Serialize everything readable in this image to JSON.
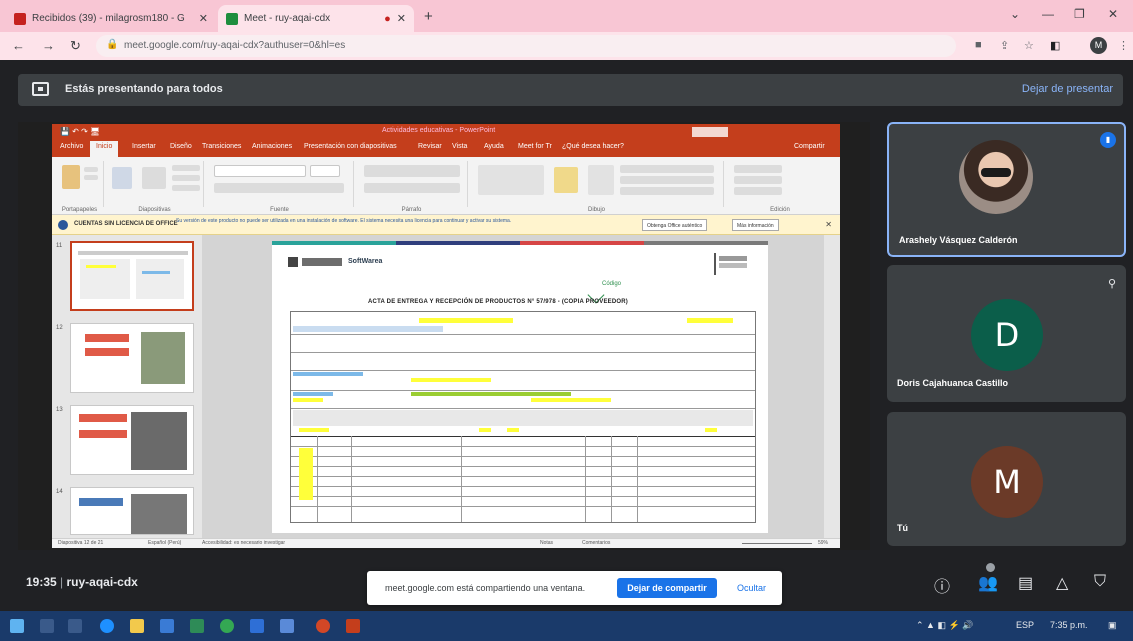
{
  "browser": {
    "tabs": [
      {
        "label": "Recibidos (39) - milagrosm180 - G",
        "favicon_color": "#c5221f"
      },
      {
        "label": "Meet - ruy-aqai-cdx",
        "favicon_color": "#1e8e3e",
        "active": true
      }
    ],
    "new_tab_glyph": "+",
    "address": "meet.google.com/ruy-aqai-cdx?authuser=0&hl=es",
    "window_controls": [
      "⌄",
      "—",
      "❐",
      "✕"
    ],
    "profile_letter": "M"
  },
  "presenting_bar": {
    "text": "Estás presentando para todos",
    "stop_label": "Dejar de presentar"
  },
  "powerpoint": {
    "doc_title": "Actividades educativas - PowerPoint",
    "tabs": [
      "Archivo",
      "Inicio",
      "Insertar",
      "Diseño",
      "Transiciones",
      "Animaciones",
      "Presentación con diapositivas",
      "Revisar",
      "Vista",
      "Ayuda",
      "Meet for Tr",
      "¿Qué desea hacer?",
      "Compartir"
    ],
    "ribbon_groups": [
      "Portapapeles",
      "Diapositivas",
      "Fuente",
      "Párrafo",
      "Dibujo",
      "Edición"
    ],
    "warning_title": "CUENTAS SIN LICENCIA DE OFFICE",
    "warning_text": "Su versión de este producto no puede ser utilizada en una instalación de software. El sistema necesita una licencia para continuar y activar su sistema.",
    "warning_buttons": [
      "Obtenga Office auténtico",
      "Más información"
    ],
    "thumb_numbers": [
      "11",
      "12",
      "13",
      "14"
    ],
    "slide": {
      "header_logo_text": "SoftWarea",
      "codigo_label": "Código",
      "title": "ACTA DE ENTREGA Y RECEPCIÓN DE PRODUCTOS N° 57/978 - (COPIA PROVEEDOR)"
    },
    "status": [
      "Diapositiva 12 de 21",
      "Español (Perú)",
      "Accesibilidad: es necesario investigar"
    ],
    "status_right": [
      "Notas",
      "Comentarios"
    ],
    "zoom": "59%"
  },
  "participants": [
    {
      "name": "Arashely Vásquez Calderón",
      "type": "photo",
      "speaking": true
    },
    {
      "name": "Doris Cajahuanca Castillo",
      "letter": "D",
      "color": "#0b5e4a",
      "muted": true
    },
    {
      "name": "Tú",
      "letter": "M",
      "color": "#6b3a28"
    }
  ],
  "bottom_bar": {
    "time": "19:35",
    "meeting_code": "ruy-aqai-cdx",
    "icons": [
      "info-icon",
      "people-icon",
      "chat-icon",
      "activities-icon",
      "host-controls-icon"
    ]
  },
  "share_notice": {
    "text": "meet.google.com está compartiendo una ventana.",
    "stop_label": "Dejar de compartir",
    "hide_label": "Ocultar"
  },
  "taskbar": {
    "clock": "7:35 p.m.",
    "lang": "ESP"
  }
}
